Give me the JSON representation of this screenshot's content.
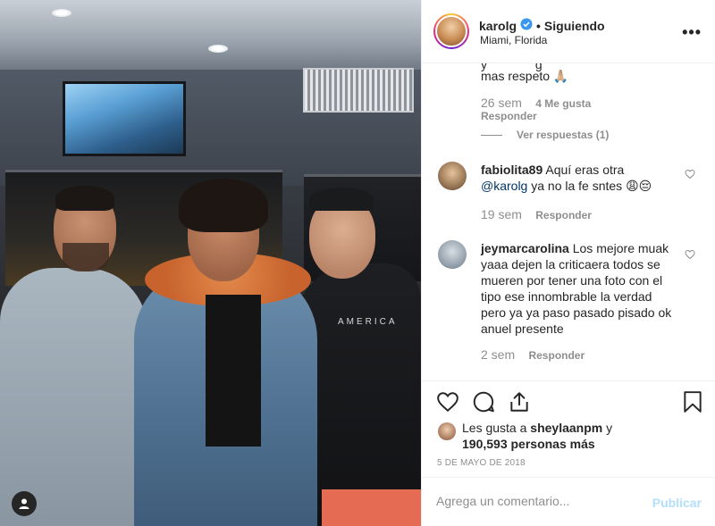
{
  "header": {
    "username": "karolg",
    "dot": "•",
    "follow_status": "Siguiendo",
    "location": "Miami, Florida",
    "more_icon": "more-horizontal-icon"
  },
  "photo": {
    "shirt_text": "AMERICA",
    "profile_icon": "user-icon"
  },
  "comments": [
    {
      "text_partial_top": "y",
      "text_partial_top2": "g",
      "text_line": "mas respeto 🙏🏼",
      "time": "26 sem",
      "likes": "4 Me gusta",
      "reply": "Responder",
      "view_replies": "Ver respuestas (1)"
    },
    {
      "username": "fabiolita89",
      "text_a": "Aquí eras otra",
      "mention": "@karolg",
      "text_b": "ya no la fe sntes 😩😔",
      "time": "19 sem",
      "reply": "Responder"
    },
    {
      "username": "jeymarcarolina",
      "text_lines": [
        "Los mejore muak",
        "yaaa dejen la criticaera todos se",
        "mueren por tener una foto con el",
        "tipo ese innombrable la verdad",
        "pero ya ya paso pasado pisado ok",
        "anuel presente"
      ],
      "time": "2 sem",
      "reply": "Responder"
    }
  ],
  "actions": {
    "likes_prefix": "Les gusta a",
    "likes_user": "sheylaanpm",
    "likes_mid": "y",
    "likes_count": "190,593 personas más",
    "date": "5 DE MAYO DE 2018"
  },
  "add_comment": {
    "placeholder": "Agrega un comentario...",
    "post_label": "Publicar"
  }
}
